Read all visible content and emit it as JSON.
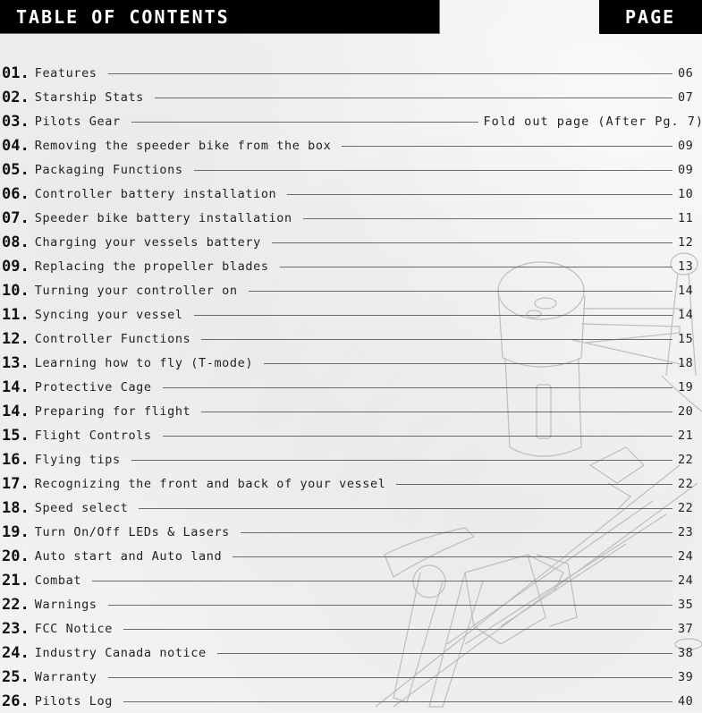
{
  "header": {
    "title": "TABLE OF CONTENTS",
    "page_label": "PAGE"
  },
  "entries": [
    {
      "num": "01.",
      "title": "Features",
      "page": "06"
    },
    {
      "num": "02.",
      "title": "Starship Stats",
      "page": "07"
    },
    {
      "num": "03.",
      "title": "Pilots Gear",
      "page": "Fold out page (After Pg. 7)"
    },
    {
      "num": "04.",
      "title": "Removing the speeder bike from the box",
      "page": "09"
    },
    {
      "num": "05.",
      "title": "Packaging Functions",
      "page": "09"
    },
    {
      "num": "06.",
      "title": "Controller battery installation",
      "page": "10"
    },
    {
      "num": "07.",
      "title": "Speeder bike battery installation",
      "page": "11"
    },
    {
      "num": "08.",
      "title": "Charging your vessels battery",
      "page": "12"
    },
    {
      "num": "09.",
      "title": "Replacing the propeller blades",
      "page": "13"
    },
    {
      "num": "10.",
      "title": "Turning your controller on",
      "page": "14"
    },
    {
      "num": "11.",
      "title": "Syncing your vessel",
      "page": "14"
    },
    {
      "num": "12.",
      "title": "Controller Functions",
      "page": "15"
    },
    {
      "num": "13.",
      "title": "Learning how to fly (T-mode)",
      "page": "18"
    },
    {
      "num": "14.",
      "title": "Protective Cage",
      "page": "19"
    },
    {
      "num": "14.",
      "title": "Preparing for flight",
      "page": "20"
    },
    {
      "num": "15.",
      "title": "Flight Controls",
      "page": "21"
    },
    {
      "num": "16.",
      "title": "Flying tips",
      "page": "22"
    },
    {
      "num": "17.",
      "title": "Recognizing the front and back of your vessel",
      "page": "22"
    },
    {
      "num": "18.",
      "title": "Speed select",
      "page": "22"
    },
    {
      "num": "19.",
      "title": "Turn On/Off LEDs & Lasers",
      "page": "23"
    },
    {
      "num": "20.",
      "title": "Auto start and Auto land",
      "page": "24"
    },
    {
      "num": "21.",
      "title": "Combat",
      "page": "24"
    },
    {
      "num": "22.",
      "title": "Warnings",
      "page": "35"
    },
    {
      "num": "23.",
      "title": "FCC Notice",
      "page": "37"
    },
    {
      "num": "24.",
      "title": "Industry Canada notice",
      "page": "38"
    },
    {
      "num": "25.",
      "title": "Warranty",
      "page": "39"
    },
    {
      "num": "26.",
      "title": "Pilots Log",
      "page": "40"
    }
  ],
  "background": {
    "illustration": "speeder-bike-pencil-sketch"
  }
}
